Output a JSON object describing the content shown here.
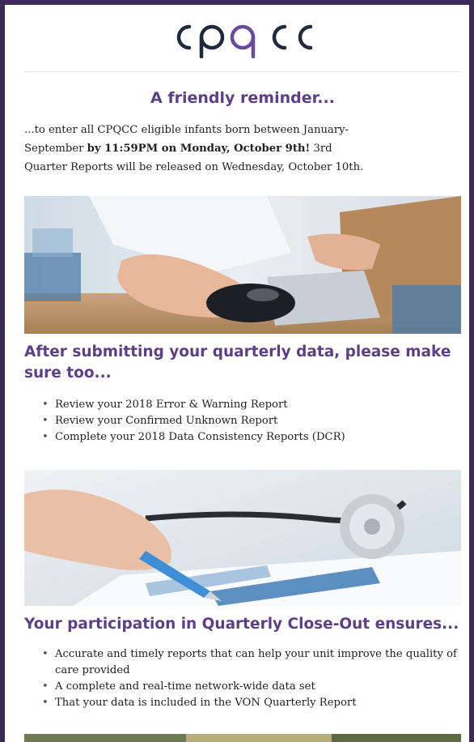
{
  "brand": {
    "logo_text": "cpqcc",
    "color": "#5c3f87",
    "frame_color": "#3d2a5a"
  },
  "reminder": {
    "heading": "A friendly reminder...",
    "line1_a": "...to enter all CPQCC eligible infants born between January-",
    "line2_a": "September ",
    "line2_bold": "by 11:59PM on Monday, October 9th!",
    "line2_c": " 3rd",
    "line3": "Quarter Reports will be released on Wednesday, October 10th."
  },
  "section1": {
    "image": "hand-on-mouse-photo",
    "heading": "After submitting your quarterly data, please make sure too...",
    "items": [
      "Review your 2018 Error & Warning Report",
      "Review your Confirmed Unknown Report",
      "Complete your 2018 Data Consistency Reports (DCR)"
    ]
  },
  "section2": {
    "image": "stethoscope-form-photo",
    "heading": "Your participation in Quarterly Close-Out ensures...",
    "items": [
      "Accurate and timely reports that can help your unit improve the quality of care provided",
      "A complete and real-time network-wide data set",
      "That your data is included in the VON Quarterly Report"
    ]
  },
  "section3": {
    "image": "magazines-photo"
  }
}
